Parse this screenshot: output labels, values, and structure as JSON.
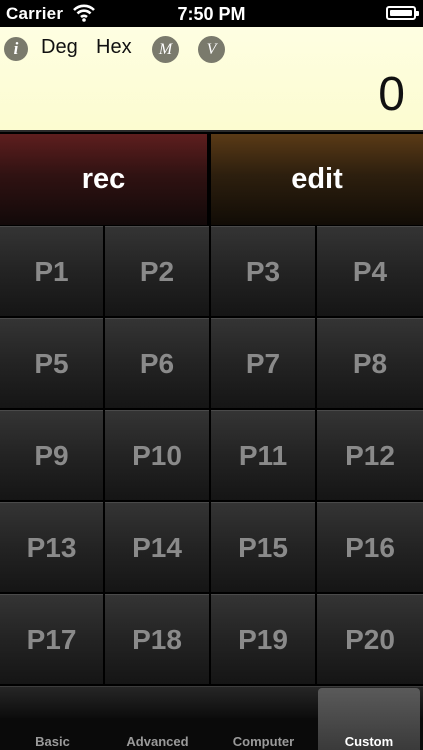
{
  "status": {
    "carrier": "Carrier",
    "time": "7:50 PM"
  },
  "display": {
    "info_icon_label": "i",
    "angle_mode": "Deg",
    "base_mode": "Hex",
    "memory_label": "M",
    "variable_label": "V",
    "value": "0"
  },
  "actions": {
    "rec": "rec",
    "edit": "edit"
  },
  "programs": [
    "P1",
    "P2",
    "P3",
    "P4",
    "P5",
    "P6",
    "P7",
    "P8",
    "P9",
    "P10",
    "P11",
    "P12",
    "P13",
    "P14",
    "P15",
    "P16",
    "P17",
    "P18",
    "P19",
    "P20"
  ],
  "tabs": [
    {
      "label": "Basic",
      "active": false
    },
    {
      "label": "Advanced",
      "active": false
    },
    {
      "label": "Computer",
      "active": false
    },
    {
      "label": "Custom",
      "active": true
    }
  ]
}
